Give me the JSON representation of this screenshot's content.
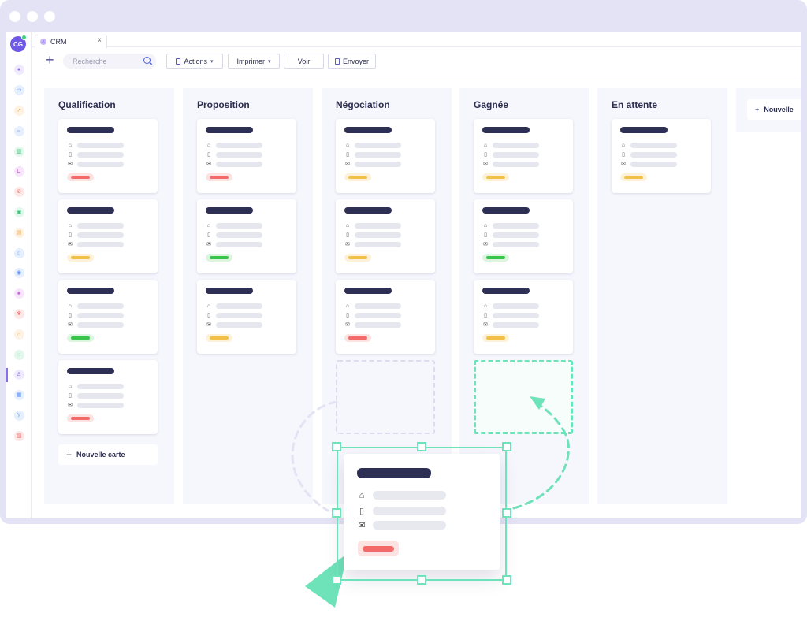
{
  "app": {
    "tab_label": "CRM",
    "tab_close": "×",
    "avatar_initials": "CG"
  },
  "rail": {
    "icons": [
      {
        "name": "users-icon",
        "color": "#8a6df0",
        "bg": "#efeafd",
        "glyph": "●"
      },
      {
        "name": "calendar-icon",
        "color": "#5a8ef0",
        "bg": "#e6effd",
        "glyph": "▭"
      },
      {
        "name": "trend-icon",
        "color": "#f0a84a",
        "bg": "#fdf2e4",
        "glyph": "↗"
      },
      {
        "name": "dumbbell-icon",
        "color": "#5a8ef0",
        "bg": "#e6effd",
        "glyph": "⇔"
      },
      {
        "name": "chart-icon",
        "color": "#3bc47a",
        "bg": "#e4f7ec",
        "glyph": "▥"
      },
      {
        "name": "cart-icon",
        "color": "#c45ad8",
        "bg": "#f7e6fb",
        "glyph": "⊔"
      },
      {
        "name": "blocked-icon",
        "color": "#f06a6a",
        "bg": "#fde8e8",
        "glyph": "⊘"
      },
      {
        "name": "briefcase-icon",
        "color": "#3bc47a",
        "bg": "#e4f7ec",
        "glyph": "▣"
      },
      {
        "name": "document-icon",
        "color": "#f0a84a",
        "bg": "#fdf2e4",
        "glyph": "▤"
      },
      {
        "name": "clipboard-icon",
        "color": "#5a8ef0",
        "bg": "#e6effd",
        "glyph": "▯"
      },
      {
        "name": "bot-icon",
        "color": "#5a8ef0",
        "bg": "#e6effd",
        "glyph": "◉"
      },
      {
        "name": "box-icon",
        "color": "#c45ad8",
        "bg": "#f7e6fb",
        "glyph": "◈"
      },
      {
        "name": "settings-icon",
        "color": "#f06a6a",
        "bg": "#fde8e8",
        "glyph": "✻"
      },
      {
        "name": "headset-icon",
        "color": "#f0a84a",
        "bg": "#fdf2e4",
        "glyph": "∩"
      },
      {
        "name": "chat-icon",
        "color": "#3bc47a",
        "bg": "#e4f7ec",
        "glyph": "◌"
      },
      {
        "name": "contact-icon",
        "color": "#8a6df0",
        "bg": "#efeafd",
        "glyph": "♙",
        "active": true
      },
      {
        "name": "building-icon",
        "color": "#5a8ef0",
        "bg": "#e6effd",
        "glyph": "▦"
      },
      {
        "name": "branch-icon",
        "color": "#5a8ef0",
        "bg": "#e6effd",
        "glyph": "Ⲩ"
      },
      {
        "name": "inbox-icon",
        "color": "#f06a6a",
        "bg": "#fde8e8",
        "glyph": "▨"
      }
    ]
  },
  "toolbar": {
    "search_placeholder": "Recherche",
    "actions_label": "Actions",
    "print_label": "Imprimer",
    "view_label": "Voir",
    "send_label": "Envoyer"
  },
  "board": {
    "colors": {
      "red": {
        "bar": "#f26a6a",
        "bg": "#fde2e2"
      },
      "yellow": {
        "bar": "#f2bf4a",
        "bg": "#fdf1d8"
      },
      "green": {
        "bar": "#3bc44a",
        "bg": "#dcf5df"
      }
    },
    "columns": [
      {
        "title": "Qualification",
        "cards": [
          "red",
          "yellow",
          "green",
          "red"
        ],
        "new_card": "Nouvelle carte"
      },
      {
        "title": "Proposition",
        "cards": [
          "red",
          "green",
          "yellow"
        ]
      },
      {
        "title": "Négociation",
        "cards": [
          "yellow",
          "yellow",
          "red"
        ]
      },
      {
        "title": "Gagnée",
        "cards": [
          "yellow",
          "green",
          "yellow"
        ]
      },
      {
        "title": "En attente",
        "cards": [
          "yellow"
        ]
      }
    ],
    "new_column_label": "Nouvelle"
  },
  "drag": {
    "status": "red",
    "cursor_color": "#6ee2b8",
    "arc_color": "#e4e2f3"
  }
}
